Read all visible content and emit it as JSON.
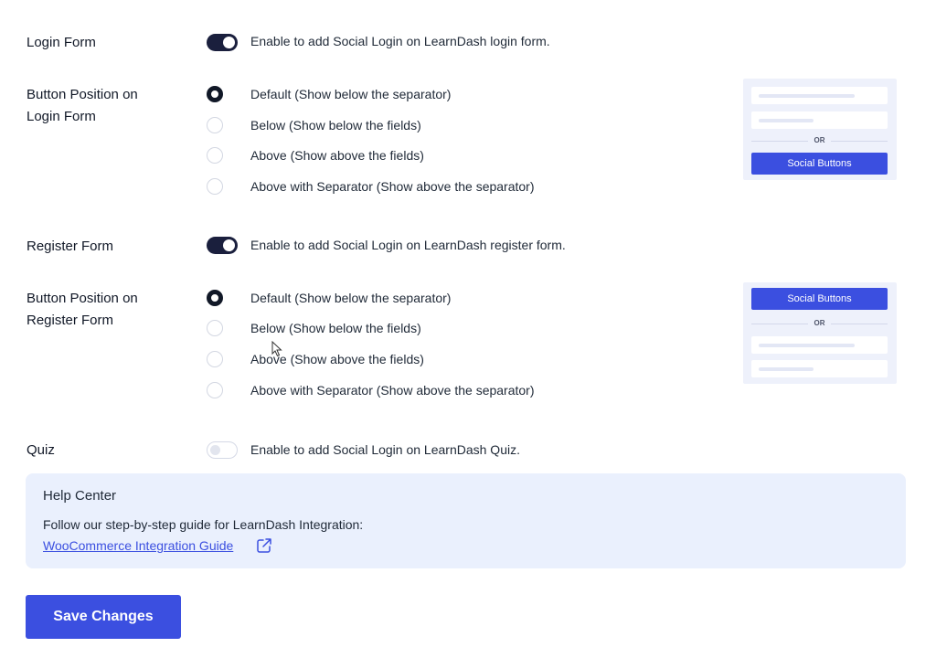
{
  "login_form": {
    "label": "Login Form",
    "toggle_on": true,
    "description": "Enable to add Social Login on LearnDash login form."
  },
  "login_position": {
    "label_line1": "Button Position on",
    "label_line2": "Login Form",
    "options": [
      "Default (Show below the separator)",
      "Below (Show below the fields)",
      "Above (Show above the fields)",
      "Above with Separator (Show above the separator)"
    ],
    "selected_index": 0,
    "preview": {
      "or_text": "OR",
      "button_text": "Social Buttons"
    }
  },
  "register_form": {
    "label": "Register Form",
    "toggle_on": true,
    "description": "Enable to add Social Login on LearnDash register form."
  },
  "register_position": {
    "label_line1": "Button Position on",
    "label_line2": "Register Form",
    "options": [
      "Default (Show below the separator)",
      "Below (Show below the fields)",
      "Above (Show above the fields)",
      "Above with Separator (Show above the separator)"
    ],
    "selected_index": 0,
    "preview": {
      "or_text": "OR",
      "button_text": "Social Buttons"
    }
  },
  "quiz": {
    "label": "Quiz",
    "toggle_on": false,
    "description": "Enable to add Social Login on LearnDash Quiz."
  },
  "help_center": {
    "title": "Help Center",
    "text": "Follow our step-by-step guide for LearnDash Integration:",
    "link_text": "WooCommerce Integration Guide",
    "link_icon": "external-link-icon"
  },
  "save_button": "Save Changes",
  "colors": {
    "accent": "#3b4fe0",
    "toggle_on": "#1a1f3d",
    "help_bg": "#eaf0fd",
    "preview_bg": "#eef1fb"
  }
}
